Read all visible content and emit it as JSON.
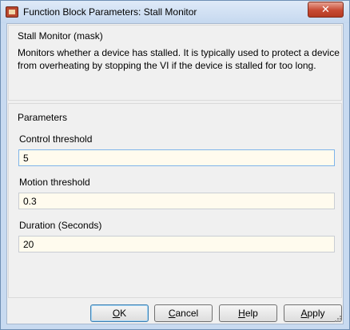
{
  "window": {
    "title": "Function Block Parameters: Stall Monitor",
    "close_glyph": "✕"
  },
  "mask": {
    "title": "Stall Monitor (mask)",
    "description": "Monitors whether a device has stalled. It is typically used to protect a device from overheating by stopping the VI if the device is stalled for too long."
  },
  "parameters": {
    "title": "Parameters",
    "fields": [
      {
        "label": "Control threshold",
        "value": "5"
      },
      {
        "label": "Motion threshold",
        "value": "0.3"
      },
      {
        "label": "Duration (Seconds)",
        "value": "20"
      }
    ]
  },
  "buttons": {
    "ok": {
      "mnemonic": "O",
      "rest": "K"
    },
    "cancel": {
      "mnemonic": "C",
      "rest": "ancel"
    },
    "help": {
      "mnemonic": "H",
      "rest": "elp"
    },
    "apply": {
      "mnemonic": "A",
      "rest": "pply"
    }
  },
  "colors": {
    "input_background": "#fffbee",
    "close_button": "#c74a33",
    "titlebar": "#c5d8ef"
  },
  "icons": [
    "simulink-block-icon",
    "close-icon",
    "resize-grip-icon"
  ]
}
